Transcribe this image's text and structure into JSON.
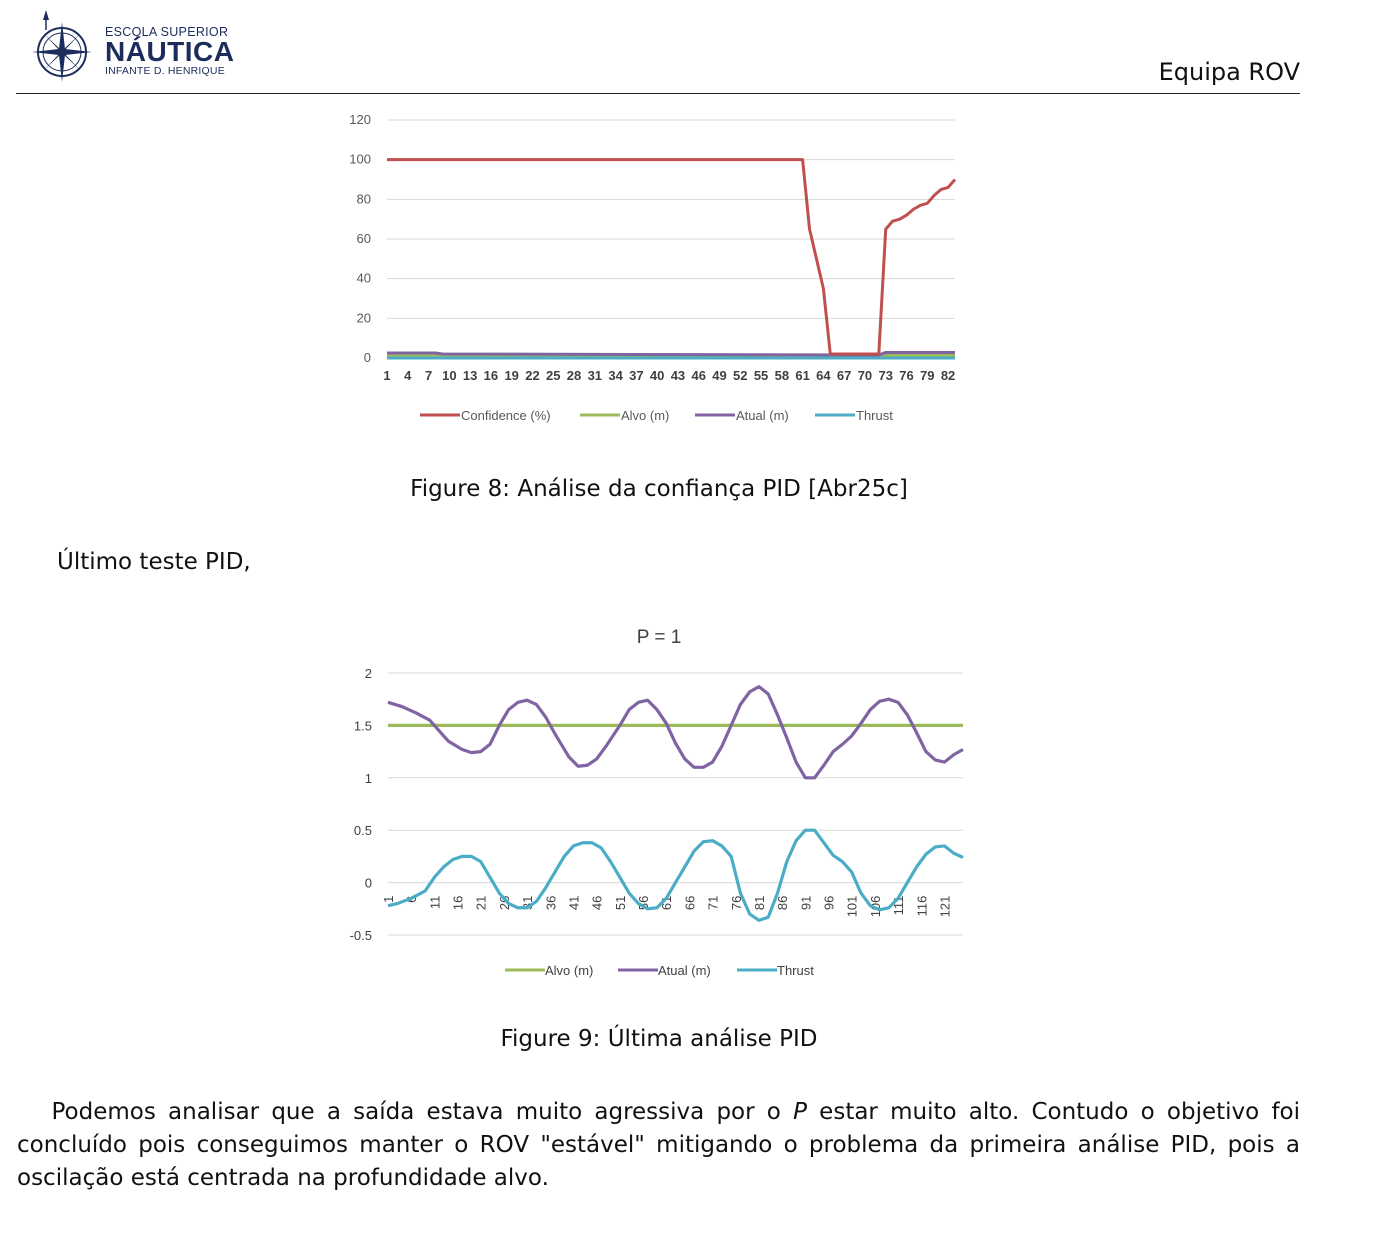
{
  "header": {
    "logo": {
      "line1": "ESCOLA SUPERIOR",
      "line2": "NÁUTICA",
      "line3": "INFANTE D. HENRIQUE"
    },
    "team": "Equipa ROV"
  },
  "figure8": {
    "caption": "Figure 8: Análise da confiança PID [Abr25c]",
    "chart_data": {
      "type": "line",
      "title": "",
      "ylim": [
        0,
        120
      ],
      "yticks": [
        "0",
        "20",
        "40",
        "60",
        "80",
        "100",
        "120"
      ],
      "xticks": [
        "1",
        "4",
        "7",
        "10",
        "13",
        "16",
        "19",
        "22",
        "25",
        "28",
        "31",
        "34",
        "37",
        "40",
        "43",
        "46",
        "49",
        "52",
        "55",
        "58",
        "61",
        "64",
        "67",
        "70",
        "73",
        "76",
        "79",
        "82"
      ],
      "grid": true,
      "legend": "bottom",
      "series": [
        {
          "name": "Confidence (%)",
          "color": "#c0504d",
          "points": [
            [
              1,
              100
            ],
            [
              61,
              100
            ],
            [
              62,
              65
            ],
            [
              63,
              50
            ],
            [
              64,
              35
            ],
            [
              65,
              2
            ],
            [
              72,
              2
            ],
            [
              73,
              65
            ],
            [
              74,
              69
            ],
            [
              75,
              70
            ],
            [
              76,
              72
            ],
            [
              77,
              75
            ],
            [
              78,
              77
            ],
            [
              79,
              78
            ],
            [
              80,
              82
            ],
            [
              81,
              85
            ],
            [
              82,
              86
            ],
            [
              83,
              90
            ]
          ]
        },
        {
          "name": "Alvo (m)",
          "color": "#9bbb59",
          "points": [
            [
              1,
              1.5
            ],
            [
              83,
              1.5
            ]
          ]
        },
        {
          "name": "Atual (m)",
          "color": "#8064a2",
          "points": [
            [
              1,
              2.5
            ],
            [
              8,
              2.5
            ],
            [
              9,
              2
            ],
            [
              72,
              1.5
            ],
            [
              73,
              2.8
            ],
            [
              83,
              2.8
            ]
          ]
        },
        {
          "name": "Thrust",
          "color": "#4bacc6",
          "points": [
            [
              1,
              0
            ],
            [
              83,
              0
            ]
          ]
        }
      ]
    }
  },
  "text_last_test": "Último teste PID,",
  "figure9": {
    "caption": "Figure 9: Última análise PID",
    "chart_data": {
      "type": "line",
      "title": "P = 1",
      "ylim": [
        -0.5,
        2
      ],
      "yticks": [
        "-0.5",
        "0",
        "0.5",
        "1",
        "1.5",
        "2"
      ],
      "xticks": [
        "1",
        "6",
        "11",
        "16",
        "21",
        "26",
        "31",
        "36",
        "41",
        "46",
        "51",
        "56",
        "61",
        "66",
        "71",
        "76",
        "81",
        "86",
        "91",
        "96",
        "101",
        "106",
        "111",
        "116",
        "121"
      ],
      "grid": true,
      "legend": "bottom",
      "series": [
        {
          "name": "Alvo (m)",
          "color": "#9bbb59",
          "points": [
            [
              1,
              1.5
            ],
            [
              125,
              1.5
            ]
          ]
        },
        {
          "name": "Atual (m)",
          "color": "#8064a2",
          "points": [
            [
              1,
              1.72
            ],
            [
              4,
              1.68
            ],
            [
              7,
              1.62
            ],
            [
              10,
              1.55
            ],
            [
              12,
              1.45
            ],
            [
              14,
              1.35
            ],
            [
              17,
              1.27
            ],
            [
              19,
              1.24
            ],
            [
              21,
              1.25
            ],
            [
              23,
              1.32
            ],
            [
              25,
              1.5
            ],
            [
              27,
              1.65
            ],
            [
              29,
              1.72
            ],
            [
              31,
              1.74
            ],
            [
              33,
              1.7
            ],
            [
              35,
              1.58
            ],
            [
              37,
              1.42
            ],
            [
              40,
              1.2
            ],
            [
              42,
              1.11
            ],
            [
              44,
              1.12
            ],
            [
              46,
              1.18
            ],
            [
              48,
              1.3
            ],
            [
              51,
              1.5
            ],
            [
              53,
              1.65
            ],
            [
              55,
              1.72
            ],
            [
              57,
              1.74
            ],
            [
              59,
              1.65
            ],
            [
              61,
              1.52
            ],
            [
              63,
              1.33
            ],
            [
              65,
              1.18
            ],
            [
              67,
              1.1
            ],
            [
              69,
              1.1
            ],
            [
              71,
              1.15
            ],
            [
              73,
              1.3
            ],
            [
              75,
              1.5
            ],
            [
              77,
              1.7
            ],
            [
              79,
              1.82
            ],
            [
              81,
              1.87
            ],
            [
              83,
              1.8
            ],
            [
              85,
              1.6
            ],
            [
              87,
              1.38
            ],
            [
              89,
              1.15
            ],
            [
              91,
              1.0
            ],
            [
              93,
              1.0
            ],
            [
              95,
              1.12
            ],
            [
              97,
              1.25
            ],
            [
              99,
              1.32
            ],
            [
              101,
              1.4
            ],
            [
              103,
              1.52
            ],
            [
              105,
              1.65
            ],
            [
              107,
              1.73
            ],
            [
              109,
              1.75
            ],
            [
              111,
              1.72
            ],
            [
              113,
              1.6
            ],
            [
              115,
              1.43
            ],
            [
              117,
              1.25
            ],
            [
              119,
              1.17
            ],
            [
              121,
              1.15
            ],
            [
              123,
              1.22
            ],
            [
              125,
              1.27
            ]
          ]
        },
        {
          "name": "Thrust",
          "color": "#4bacc6",
          "points": [
            [
              1,
              -0.22
            ],
            [
              3,
              -0.2
            ],
            [
              6,
              -0.15
            ],
            [
              9,
              -0.08
            ],
            [
              11,
              0.05
            ],
            [
              13,
              0.15
            ],
            [
              15,
              0.22
            ],
            [
              17,
              0.25
            ],
            [
              19,
              0.25
            ],
            [
              21,
              0.2
            ],
            [
              23,
              0.05
            ],
            [
              25,
              -0.1
            ],
            [
              27,
              -0.2
            ],
            [
              29,
              -0.24
            ],
            [
              31,
              -0.24
            ],
            [
              33,
              -0.18
            ],
            [
              35,
              -0.05
            ],
            [
              37,
              0.1
            ],
            [
              39,
              0.25
            ],
            [
              41,
              0.35
            ],
            [
              43,
              0.38
            ],
            [
              45,
              0.38
            ],
            [
              47,
              0.33
            ],
            [
              49,
              0.2
            ],
            [
              51,
              0.05
            ],
            [
              53,
              -0.1
            ],
            [
              55,
              -0.2
            ],
            [
              57,
              -0.25
            ],
            [
              59,
              -0.24
            ],
            [
              61,
              -0.15
            ],
            [
              63,
              0.0
            ],
            [
              65,
              0.15
            ],
            [
              67,
              0.3
            ],
            [
              69,
              0.39
            ],
            [
              71,
              0.4
            ],
            [
              73,
              0.35
            ],
            [
              75,
              0.25
            ],
            [
              77,
              -0.1
            ],
            [
              79,
              -0.3
            ],
            [
              81,
              -0.36
            ],
            [
              83,
              -0.33
            ],
            [
              85,
              -0.1
            ],
            [
              87,
              0.2
            ],
            [
              89,
              0.4
            ],
            [
              91,
              0.5
            ],
            [
              93,
              0.5
            ],
            [
              95,
              0.38
            ],
            [
              97,
              0.26
            ],
            [
              99,
              0.2
            ],
            [
              101,
              0.1
            ],
            [
              103,
              -0.1
            ],
            [
              105,
              -0.22
            ],
            [
              107,
              -0.26
            ],
            [
              109,
              -0.24
            ],
            [
              111,
              -0.15
            ],
            [
              113,
              0.0
            ],
            [
              115,
              0.15
            ],
            [
              117,
              0.27
            ],
            [
              119,
              0.34
            ],
            [
              121,
              0.35
            ],
            [
              123,
              0.28
            ],
            [
              125,
              0.24
            ]
          ]
        }
      ]
    }
  },
  "paragraph": {
    "before": "Podemos analisar que a saída estava muito agressiva por o ",
    "italic": "P",
    "after": " estar muito alto. Contudo o objetivo foi concluído pois conseguimos manter o ROV \"estável\" mitigando o problema da primeira análise PID, pois a oscilação está centrada na profundidade alvo."
  }
}
